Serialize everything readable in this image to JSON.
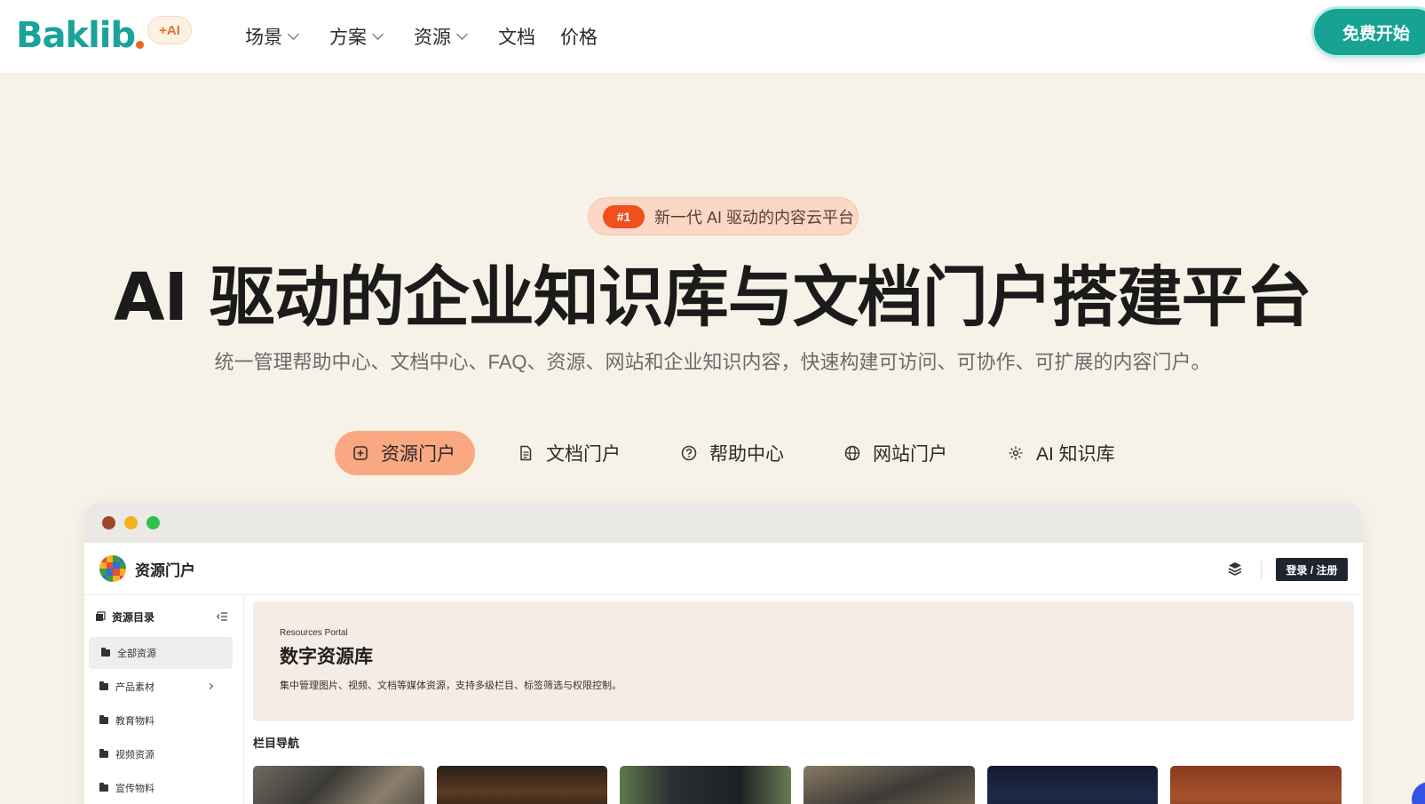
{
  "nav": {
    "brand": "Baklib",
    "ai_badge": "+AI",
    "links": [
      {
        "label": "场景",
        "dropdown": true
      },
      {
        "label": "方案",
        "dropdown": true
      },
      {
        "label": "资源",
        "dropdown": true
      },
      {
        "label": "文档",
        "dropdown": false
      },
      {
        "label": "价格",
        "dropdown": false
      }
    ],
    "cta": "免费开始"
  },
  "hero": {
    "pill_num": "#1",
    "pill_text": "新一代 AI 驱动的内容云平台",
    "title": "AI 驱动的企业知识库与文档门户搭建平台",
    "subtitle": "统一管理帮助中心、文档中心、FAQ、资源、网站和企业知识内容，快速构建可访问、可协作、可扩展的内容门户。"
  },
  "tabs": [
    {
      "label": "资源门户",
      "icon": "plus-square-icon",
      "active": true
    },
    {
      "label": "文档门户",
      "icon": "document-icon",
      "active": false
    },
    {
      "label": "帮助中心",
      "icon": "help-circle-icon",
      "active": false
    },
    {
      "label": "网站门户",
      "icon": "globe-icon",
      "active": false
    },
    {
      "label": "AI 知识库",
      "icon": "sparkle-icon",
      "active": false
    }
  ],
  "preview": {
    "window_dots": [
      "#a0462e",
      "#f2b21c",
      "#2fc24a"
    ],
    "app_title": "资源门户",
    "login": "登录 / 注册",
    "sidebar_title": "资源目录",
    "sidebar_items": [
      {
        "label": "全部资源",
        "active": true
      },
      {
        "label": "产品素材",
        "has_children": true
      },
      {
        "label": "教育物料"
      },
      {
        "label": "视频资源"
      },
      {
        "label": "宣传物料"
      }
    ],
    "banner_kicker": "Resources Portal",
    "banner_title": "数字资源库",
    "banner_desc": "集中管理图片、视频、文档等媒体资源，支持多级栏目、标签筛选与权限控制。",
    "section_title": "栏目导航"
  },
  "colors": {
    "brand": "#1aa39a",
    "accent": "#f0501c",
    "tab_active": "#f9a882",
    "page_bg": "#f7f2e7"
  }
}
